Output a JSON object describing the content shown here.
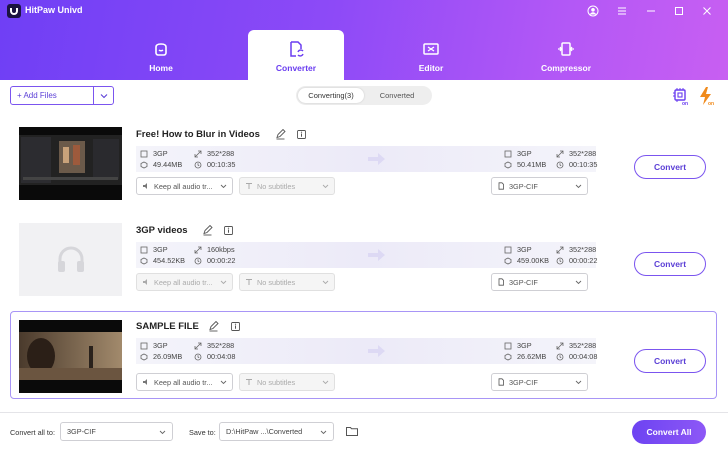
{
  "app": {
    "title": "HitPaw Univd"
  },
  "nav": {
    "tabs": [
      {
        "label": "Home"
      },
      {
        "label": "Converter"
      },
      {
        "label": "Editor"
      },
      {
        "label": "Compressor"
      }
    ],
    "active": "Converter"
  },
  "toolbar": {
    "add_files_label": "+ Add Files",
    "segments": [
      "Converting(3)",
      "Converted"
    ],
    "active_segment": "Converting(3)"
  },
  "files": [
    {
      "title": "Free! How to Blur in Videos",
      "source": {
        "format": "3GP",
        "resolution": "352*288",
        "size": "49.44MB",
        "duration": "00:10:35"
      },
      "target": {
        "format": "3GP",
        "resolution": "352*288",
        "size": "50.41MB",
        "duration": "00:10:35"
      },
      "audio_track": "Keep all audio tr...",
      "subtitles": "No subtitles",
      "output_format": "3GP-CIF",
      "convert_label": "Convert",
      "audio_enabled": true
    },
    {
      "title": "3GP videos",
      "source": {
        "format": "3GP",
        "resolution": "160kbps",
        "size": "454.52KB",
        "duration": "00:00:22"
      },
      "target": {
        "format": "3GP",
        "resolution": "352*288",
        "size": "459.00KB",
        "duration": "00:00:22"
      },
      "audio_track": "Keep all audio tr...",
      "subtitles": "No subtitles",
      "output_format": "3GP-CIF",
      "convert_label": "Convert",
      "audio_enabled": false
    },
    {
      "title": "SAMPLE FILE",
      "source": {
        "format": "3GP",
        "resolution": "352*288",
        "size": "26.09MB",
        "duration": "00:04:08"
      },
      "target": {
        "format": "3GP",
        "resolution": "352*288",
        "size": "26.62MB",
        "duration": "00:04:08"
      },
      "audio_track": "Keep all audio tr...",
      "subtitles": "No subtitles",
      "output_format": "3GP-CIF",
      "convert_label": "Convert",
      "audio_enabled": true
    }
  ],
  "footer": {
    "convert_all_to_label": "Convert all to:",
    "convert_all_to_value": "3GP-CIF",
    "save_to_label": "Save to:",
    "save_to_value": "D:\\HitPaw ...\\Converted",
    "convert_all_label": "Convert All"
  },
  "colors": {
    "accent": "#6f3ff5",
    "header_end": "#c85ff2",
    "button_border": "#7b55ef"
  }
}
